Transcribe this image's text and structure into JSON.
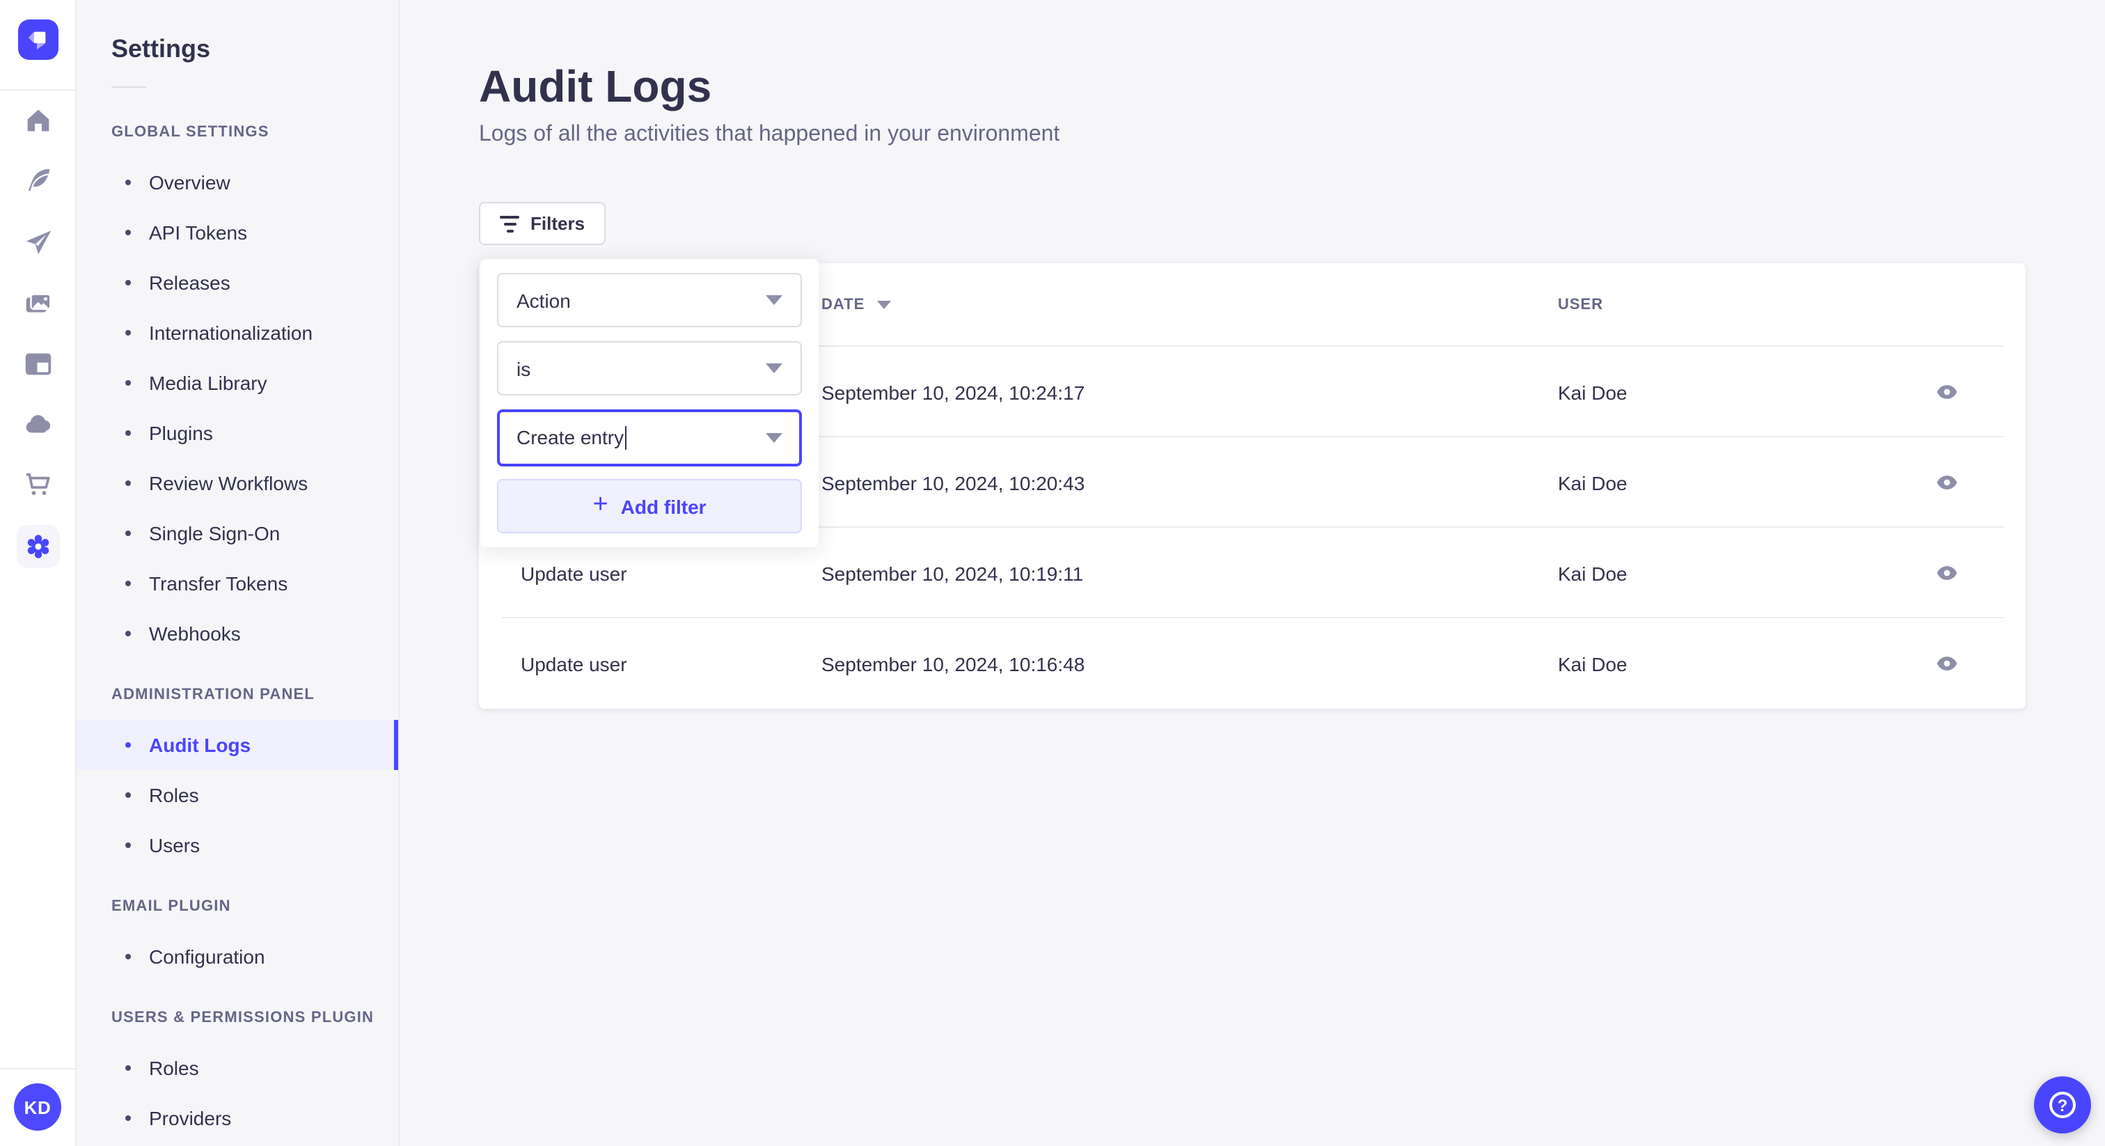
{
  "colors": {
    "primary": "#4945ff",
    "primary_light_bg": "#f0f0ff",
    "text_dark": "#32324d",
    "text_muted": "#666687",
    "icon_gray": "#8e8ea9",
    "border": "#dcdce4",
    "divider": "#eaeaef",
    "app_bg": "#f6f6f9",
    "surface": "#ffffff"
  },
  "icon_rail": {
    "icons": [
      {
        "name": "strapi-logo"
      },
      {
        "name": "home-icon"
      },
      {
        "name": "feather-icon"
      },
      {
        "name": "paper-plane-icon"
      },
      {
        "name": "media-library-icon"
      },
      {
        "name": "layout-icon"
      },
      {
        "name": "cloud-icon"
      },
      {
        "name": "cart-icon"
      },
      {
        "name": "settings-gear-icon",
        "active": true
      }
    ],
    "avatar_initials": "KD"
  },
  "sidebar": {
    "title": "Settings",
    "sections": [
      {
        "label": "GLOBAL SETTINGS",
        "items": [
          {
            "label": "Overview"
          },
          {
            "label": "API Tokens"
          },
          {
            "label": "Releases"
          },
          {
            "label": "Internationalization"
          },
          {
            "label": "Media Library"
          },
          {
            "label": "Plugins"
          },
          {
            "label": "Review Workflows"
          },
          {
            "label": "Single Sign-On"
          },
          {
            "label": "Transfer Tokens"
          },
          {
            "label": "Webhooks"
          }
        ]
      },
      {
        "label": "ADMINISTRATION PANEL",
        "items": [
          {
            "label": "Audit Logs",
            "active": true
          },
          {
            "label": "Roles"
          },
          {
            "label": "Users"
          }
        ]
      },
      {
        "label": "EMAIL PLUGIN",
        "items": [
          {
            "label": "Configuration"
          }
        ]
      },
      {
        "label": "USERS & PERMISSIONS PLUGIN",
        "items": [
          {
            "label": "Roles"
          },
          {
            "label": "Providers"
          }
        ]
      }
    ]
  },
  "header": {
    "title": "Audit Logs",
    "subtitle": "Logs of all the activities that happened in your environment"
  },
  "toolbar": {
    "filters_label": "Filters"
  },
  "filter_popover": {
    "field_value": "Action",
    "operator_value": "is",
    "value_text": "Create entry",
    "plus_glyph": "+",
    "add_filter_label": "Add filter"
  },
  "table": {
    "columns": [
      {
        "id": "action",
        "label": ""
      },
      {
        "id": "date",
        "label": "DATE",
        "sorted_desc": true
      },
      {
        "id": "user",
        "label": "USER"
      }
    ],
    "rows": [
      {
        "action": "",
        "date": "September 10, 2024, 10:24:17",
        "user": "Kai Doe"
      },
      {
        "action": "",
        "date": "September 10, 2024, 10:20:43",
        "user": "Kai Doe"
      },
      {
        "action": "Update user",
        "date": "September 10, 2024, 10:19:11",
        "user": "Kai Doe"
      },
      {
        "action": "Update user",
        "date": "September 10, 2024, 10:16:48",
        "user": "Kai Doe"
      }
    ]
  },
  "help": {
    "glyph": "?"
  }
}
